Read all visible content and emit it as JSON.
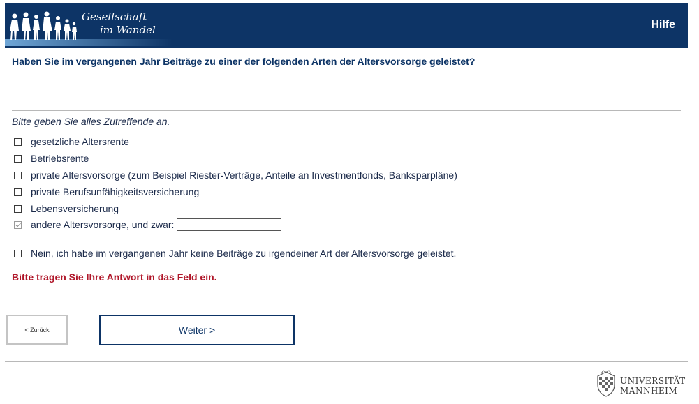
{
  "header": {
    "logo_line1": "Gesellschaft",
    "logo_line2": "im Wandel",
    "help_label": "Hilfe"
  },
  "question": "Haben Sie im vergangenen Jahr Beiträge zu einer der folgenden Arten der Altersvorsorge geleistet?",
  "instruction": "Bitte geben Sie alles Zutreffende an.",
  "options": [
    {
      "label": "gesetzliche Altersrente",
      "checked": false
    },
    {
      "label": "Betriebsrente",
      "checked": false
    },
    {
      "label": "private Altersvorsorge (zum Beispiel Riester-Verträge, Anteile an Investmentfonds, Banksparpläne)",
      "checked": false
    },
    {
      "label": "private Berufsunfähigkeitsversicherung",
      "checked": false
    },
    {
      "label": "Lebensversicherung",
      "checked": false
    },
    {
      "label": "andere Altersvorsorge, und zwar:",
      "checked": true,
      "input_value": ""
    },
    {
      "label": "Nein, ich habe im vergangenen Jahr keine Beiträge zu irgendeiner Art der Altersvorsorge geleistet.",
      "checked": false
    }
  ],
  "error_message": "Bitte tragen Sie Ihre Antwort in das Feld ein.",
  "nav": {
    "back_label": "< Zurück",
    "next_label": "Weiter >"
  },
  "footer": {
    "university_line1": "UNIVERSITÄT",
    "university_line2": "MANNHEIM"
  },
  "colors": {
    "header_bg": "#0d3466",
    "error": "#b0172a",
    "text": "#1b2a4a"
  }
}
